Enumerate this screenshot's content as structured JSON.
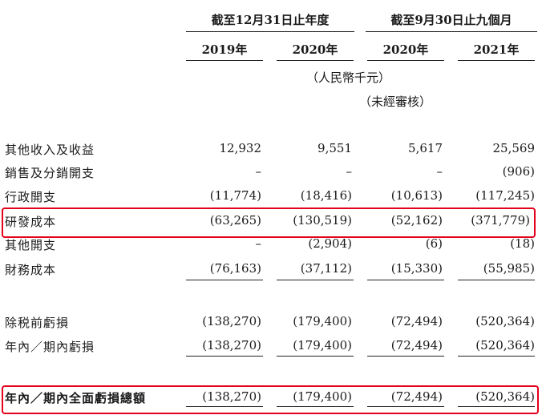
{
  "header": {
    "group1": "截至12月31日止年度",
    "group2": "截至9月30日止九個月",
    "years": [
      "2019年",
      "2020年",
      "2020年",
      "2021年"
    ],
    "currency": "（人民幣千元）",
    "unaudited": "（未經審核）"
  },
  "rows": [
    {
      "label": "其他收入及收益",
      "values": [
        "12,932",
        "9,551",
        "5,617",
        "25,569"
      ]
    },
    {
      "label": "銷售及分銷開支",
      "values": [
        "–",
        "–",
        "–",
        "(906)"
      ]
    },
    {
      "label": "行政開支",
      "values": [
        "(11,774)",
        "(18,416)",
        "(10,613)",
        "(117,245)"
      ]
    },
    {
      "label": "研發成本",
      "values": [
        "(63,265)",
        "(130,519)",
        "(52,162)",
        "(371,779)"
      ]
    },
    {
      "label": "其他開支",
      "values": [
        "–",
        "(2,904)",
        "(6)",
        "(18)"
      ]
    },
    {
      "label": "財務成本",
      "values": [
        "(76,163)",
        "(37,112)",
        "(15,330)",
        "(55,985)"
      ]
    },
    {
      "label": "除税前虧損",
      "values": [
        "(138,270)",
        "(179,400)",
        "(72,494)",
        "(520,364)"
      ]
    },
    {
      "label": "年內／期內虧損",
      "values": [
        "(138,270)",
        "(179,400)",
        "(72,494)",
        "(520,364)"
      ]
    },
    {
      "label": "年內／期內全面虧損總額",
      "values": [
        "(138,270)",
        "(179,400)",
        "(72,494)",
        "(520,364)"
      ]
    }
  ],
  "highlight_color": "#e3001b"
}
